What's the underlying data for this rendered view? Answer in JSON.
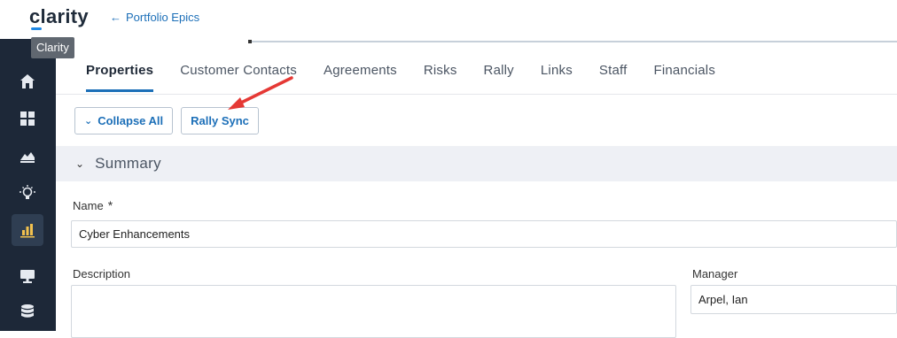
{
  "app": {
    "logo": "clarity",
    "tooltip": "Clarity"
  },
  "nav": {
    "back_label": "Portfolio Epics",
    "back_arrow": "←"
  },
  "sidebar": {
    "items": [
      {
        "icon": "home-icon"
      },
      {
        "icon": "dashboard-grid-icon"
      },
      {
        "icon": "mountain-chart-icon"
      },
      {
        "icon": "lightbulb-icon"
      },
      {
        "icon": "bar-chart-icon",
        "active": true
      },
      {
        "icon": "monitor-icon"
      },
      {
        "icon": "database-icon"
      }
    ]
  },
  "tabs": [
    {
      "label": "Properties",
      "active": true
    },
    {
      "label": "Customer Contacts"
    },
    {
      "label": "Agreements"
    },
    {
      "label": "Risks"
    },
    {
      "label": "Rally"
    },
    {
      "label": "Links"
    },
    {
      "label": "Staff"
    },
    {
      "label": "Financials"
    }
  ],
  "toolbar": {
    "collapse_label": "Collapse All",
    "rally_sync_label": "Rally Sync"
  },
  "section": {
    "title": "Summary"
  },
  "form": {
    "name_label": "Name",
    "name_required": "*",
    "name_value": "Cyber Enhancements",
    "description_label": "Description",
    "description_value": "",
    "manager_label": "Manager",
    "manager_value": "Arpel, Ian"
  },
  "colors": {
    "accent": "#1c6fb8",
    "sidebar": "#1d2838",
    "annotation_arrow": "#e53935"
  }
}
